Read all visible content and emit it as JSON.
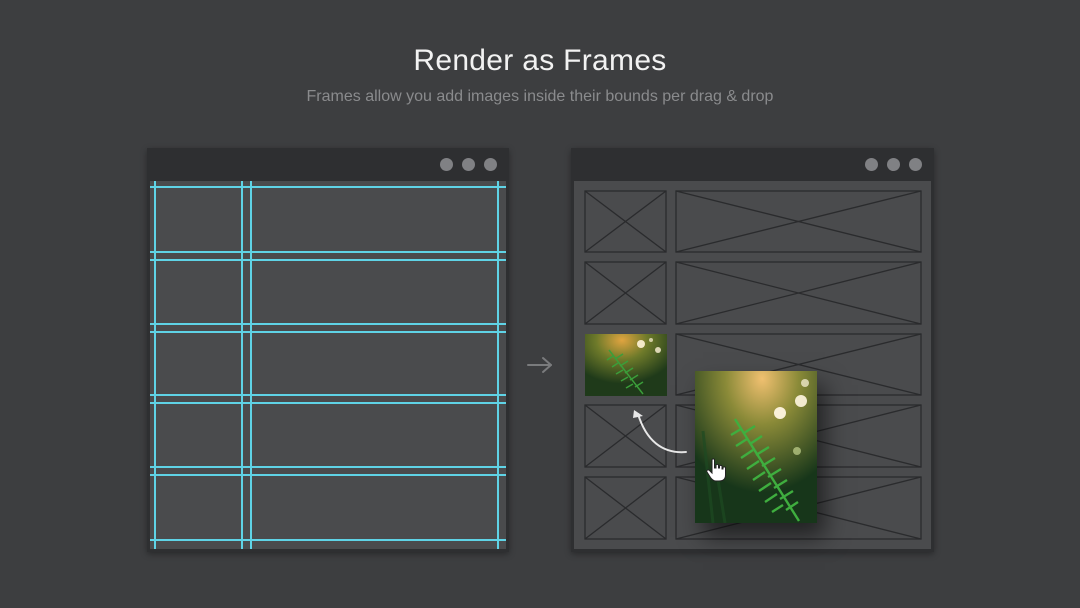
{
  "header": {
    "title": "Render as Frames",
    "subtitle": "Frames allow you add images inside their bounds per drag & drop"
  },
  "windows": {
    "left": {
      "controls": [
        "window-dot",
        "window-dot",
        "window-dot"
      ]
    },
    "right": {
      "controls": [
        "window-dot",
        "window-dot",
        "window-dot"
      ]
    }
  },
  "colors": {
    "background": "#3d3e40",
    "window_chrome": "#2e2f31",
    "canvas": "#4a4b4d",
    "guide_lines": "#5fd3e6",
    "frame_stroke": "#2a2b2d"
  },
  "icons": {
    "transition": "arrow-right-icon",
    "drag_path": "curved-arrow-icon",
    "cursor": "hand-cursor-icon"
  }
}
